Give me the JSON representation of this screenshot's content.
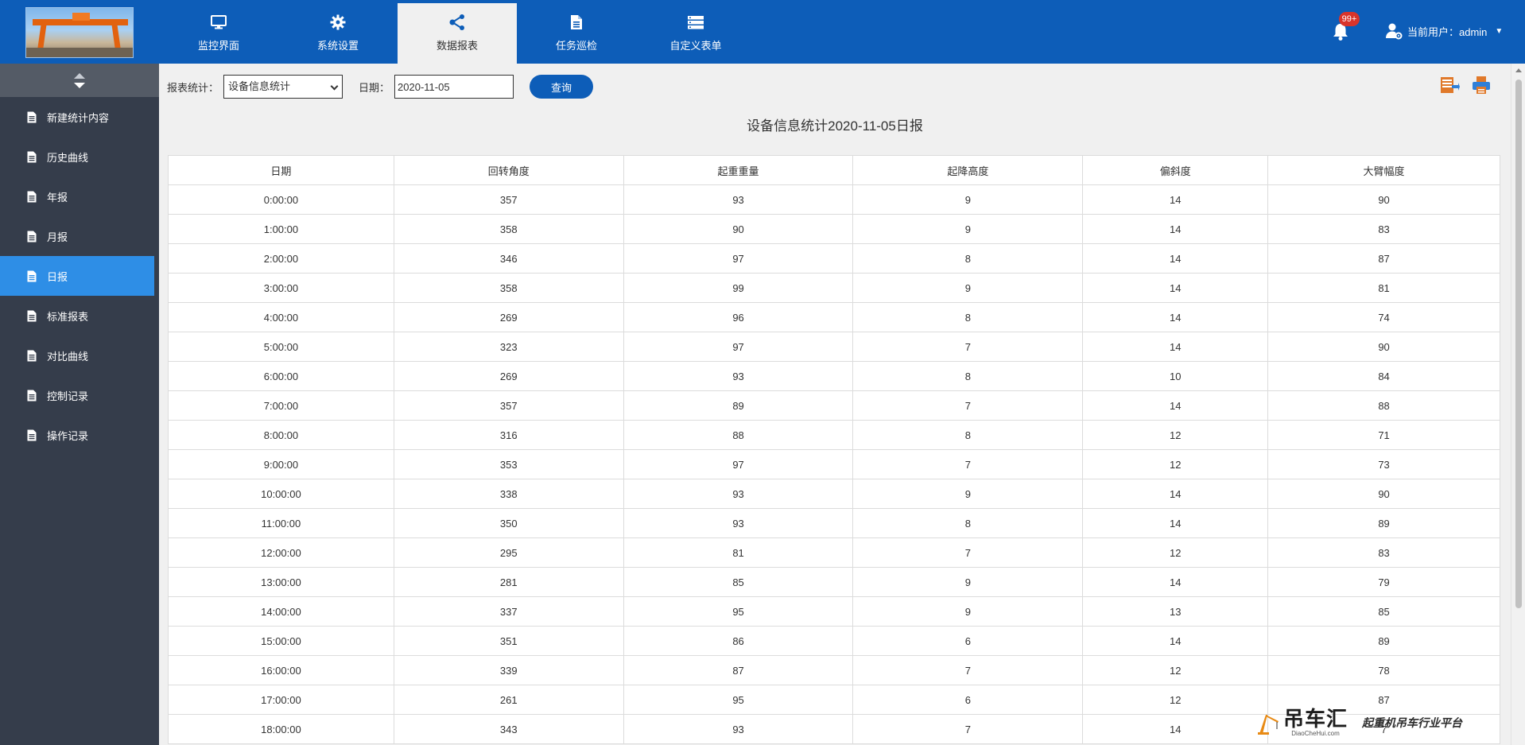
{
  "nav": {
    "items": [
      {
        "label": "监控界面",
        "icon": "monitor-icon"
      },
      {
        "label": "系统设置",
        "icon": "gear-icon"
      },
      {
        "label": "数据报表",
        "icon": "share-icon"
      },
      {
        "label": "任务巡检",
        "icon": "document-icon"
      },
      {
        "label": "自定义表单",
        "icon": "server-icon"
      }
    ],
    "active_index": 2
  },
  "notifications": {
    "badge": "99+"
  },
  "user": {
    "label": "当前用户：admin"
  },
  "sidebar": {
    "items": [
      {
        "label": "新建统计内容"
      },
      {
        "label": "历史曲线"
      },
      {
        "label": "年报"
      },
      {
        "label": "月报"
      },
      {
        "label": "日报"
      },
      {
        "label": "标准报表"
      },
      {
        "label": "对比曲线"
      },
      {
        "label": "控制记录"
      },
      {
        "label": "操作记录"
      }
    ],
    "active_index": 4
  },
  "toolbar": {
    "report_label": "报表统计：",
    "report_select_value": "设备信息统计",
    "date_label": "日期：",
    "date_value": "2020-11-05",
    "query_button": "查询"
  },
  "report": {
    "title": "设备信息统计2020-11-05日报",
    "columns": [
      "日期",
      "回转角度",
      "起重重量",
      "起降高度",
      "偏斜度",
      "大臂幅度"
    ],
    "rows": [
      [
        "0:00:00",
        "357",
        "93",
        "9",
        "14",
        "90"
      ],
      [
        "1:00:00",
        "358",
        "90",
        "9",
        "14",
        "83"
      ],
      [
        "2:00:00",
        "346",
        "97",
        "8",
        "14",
        "87"
      ],
      [
        "3:00:00",
        "358",
        "99",
        "9",
        "14",
        "81"
      ],
      [
        "4:00:00",
        "269",
        "96",
        "8",
        "14",
        "74"
      ],
      [
        "5:00:00",
        "323",
        "97",
        "7",
        "14",
        "90"
      ],
      [
        "6:00:00",
        "269",
        "93",
        "8",
        "10",
        "84"
      ],
      [
        "7:00:00",
        "357",
        "89",
        "7",
        "14",
        "88"
      ],
      [
        "8:00:00",
        "316",
        "88",
        "8",
        "12",
        "71"
      ],
      [
        "9:00:00",
        "353",
        "97",
        "7",
        "12",
        "73"
      ],
      [
        "10:00:00",
        "338",
        "93",
        "9",
        "14",
        "90"
      ],
      [
        "11:00:00",
        "350",
        "93",
        "8",
        "14",
        "89"
      ],
      [
        "12:00:00",
        "295",
        "81",
        "7",
        "12",
        "83"
      ],
      [
        "13:00:00",
        "281",
        "85",
        "9",
        "14",
        "79"
      ],
      [
        "14:00:00",
        "337",
        "95",
        "9",
        "13",
        "85"
      ],
      [
        "15:00:00",
        "351",
        "86",
        "6",
        "14",
        "89"
      ],
      [
        "16:00:00",
        "339",
        "87",
        "7",
        "12",
        "78"
      ],
      [
        "17:00:00",
        "261",
        "95",
        "6",
        "12",
        "87"
      ],
      [
        "18:00:00",
        "343",
        "93",
        "7",
        "14",
        "7"
      ]
    ]
  },
  "watermark": {
    "brand": "吊车汇",
    "domain": "DiaoCheHui.com",
    "tagline": "起重机吊车行业平台"
  },
  "colors": {
    "header": "#0d5db8",
    "sidebar": "#353d4b",
    "sidebar_active": "#2e8ee6",
    "badge": "#d9342b"
  }
}
